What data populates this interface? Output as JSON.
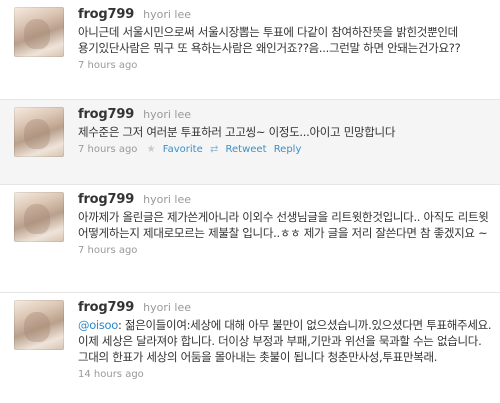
{
  "tweets": [
    {
      "screen_name": "frog799",
      "full_name": "hyori lee",
      "text": "아니근데 서울시민으로써 서울시장뽑는 투표에 다같이 참여하잔뜻을 밝힌것뿐인데 용기있단사람은 뭐구 또 욕하는사람은 왜인거죠??음...그런말 하면 안돼는건가요??",
      "time": "7 hours ago"
    },
    {
      "screen_name": "frog799",
      "full_name": "hyori lee",
      "text": "제수준은 그저 여러분 투표하러 고고씽~ 이정도...아이고 민망합니다",
      "time": "7 hours ago",
      "actions": {
        "favorite_icon": "star-icon",
        "favorite_label": "Favorite",
        "retweet_icon": "retweet-icon",
        "retweet_label": "Retweet",
        "reply_label": "Reply"
      }
    },
    {
      "screen_name": "frog799",
      "full_name": "hyori lee",
      "text": "아까제가 올린글은 제가쓴게아니라 이외수 선생님글을 리트윗한것입니다.. 아직도 리트윗 어떻게하는지 제대로모르는 제불찰 입니다..ㅎㅎ 제가 글을 저리 잘쓴다면 참 좋겠지요 ~",
      "time": "7 hours ago"
    },
    {
      "screen_name": "frog799",
      "full_name": "hyori lee",
      "mention": "@oisoo",
      "text_after_mention": ": 젊은이들이여:세상에 대해 아무 불만이 없으셨습니까.있으셨다면 투표해주세요. 이제 세상은 달라져야 합니다. 더이상 부정과 부패,기만과 위선을 묵과할 수는 없습니다.그대의 한표가 세상의 어둠을 몰아내는 촛불이 됩니다 청춘만사성,투표만복래.",
      "time": "14 hours ago"
    }
  ]
}
